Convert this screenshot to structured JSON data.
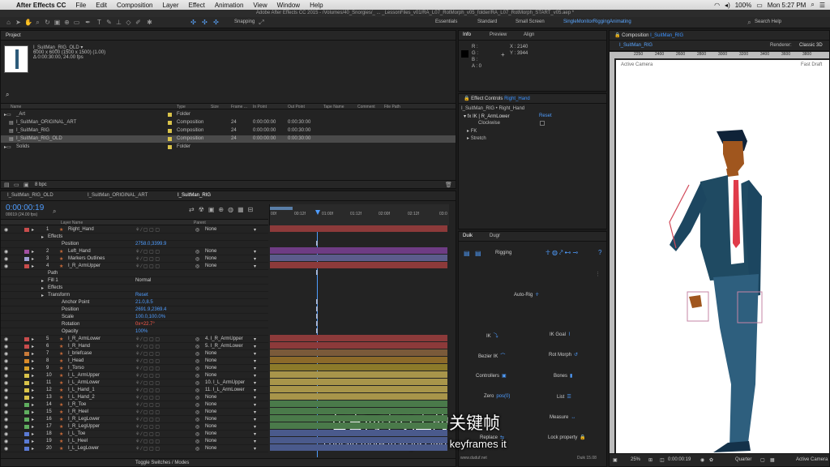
{
  "menubar": {
    "app_name": "After Effects CC",
    "items": [
      "File",
      "Edit",
      "Composition",
      "Layer",
      "Effect",
      "Animation",
      "View",
      "Window",
      "Help"
    ],
    "clock": "Mon 5:27 PM",
    "battery": "100%"
  },
  "window_title": "Adobe After Effects CC 2015 - /Volumes/40_Snorgies/_ ... _LessonFiles_v01/RA_L07_RotMorph_v05_folder/RA_L07_RotMorph_START_v05.aep *",
  "toolbar": {
    "snapping_label": "Snapping",
    "workspaces": [
      "Essentials",
      "Standard",
      "Small Screen",
      "SingleMonitorRiggingAnimating"
    ],
    "search_help": "Search Help"
  },
  "project": {
    "panel_title": "Project",
    "item_name": "I_SuitMan_RIG_OLD ▾",
    "item_dims": "6000 x 6000  (1500 x 1500) (1.00)",
    "item_duration": "Δ 0:00:30:00, 24.00 fps",
    "columns": [
      "Name",
      "Type",
      "Size",
      "Frame ...",
      "In Point",
      "Out Point",
      "Tape Name",
      "Comment",
      "File Path"
    ],
    "rows": [
      {
        "name": "_Art",
        "type": "Folder",
        "fps": "",
        "in": "",
        "out": "",
        "color": "#d9c34a"
      },
      {
        "name": "I_SuitMan_ORIGINAL_ART",
        "type": "Composition",
        "fps": "24",
        "in": "0:00:00:00",
        "out": "0:00:30:00",
        "color": "#d9c34a"
      },
      {
        "name": "I_SuitMan_RIG",
        "type": "Composition",
        "fps": "24",
        "in": "0:00:00:00",
        "out": "0:00:30:00",
        "color": "#d9c34a"
      },
      {
        "name": "I_SuitMan_RIG_OLD",
        "type": "Composition",
        "fps": "24",
        "in": "0:00:00:00",
        "out": "0:00:30:00",
        "color": "#d9c34a"
      },
      {
        "name": "Solids",
        "type": "Folder",
        "fps": "",
        "in": "",
        "out": "",
        "color": "#d9c34a"
      }
    ],
    "bpc": "8 bpc"
  },
  "info": {
    "tabs": [
      "Info",
      "Preview",
      "Align"
    ],
    "r": "R :",
    "g": "G :",
    "b": "B :",
    "a": "A : 0",
    "x": "X : 2140",
    "y": "Y : 3944"
  },
  "effect_controls": {
    "title": "Effect Controls",
    "layer": "Right_Hand",
    "path": "I_SuitMan_RIG • Right_Hand",
    "effect": "IK | R_ArmLower",
    "reset": "Reset",
    "props": [
      "Clockwise",
      "FK",
      "Stretch"
    ]
  },
  "duik": {
    "tabs": [
      "Duik",
      "Dugr"
    ],
    "rigging": "Rigging",
    "buttons": [
      "Auto-Rig",
      "IK",
      "IK Goal",
      "Bezier IK",
      "Rot Morph",
      "Controllers",
      "Bones",
      "Zero",
      "List",
      "Measure",
      "Replace",
      "Lock property"
    ],
    "url": "www.duduf.net",
    "version": "Duik 15.08"
  },
  "composition": {
    "panel_title": "Composition",
    "comp_name": "I_SuitMan_RIG",
    "tab": "I_SuitMan_RIG",
    "renderer_label": "Renderer:",
    "renderer": "Classic 3D",
    "camera": "Active Camera",
    "draft": "Fast Draft",
    "ruler": [
      "2250",
      "2400",
      "2600",
      "2800",
      "3000",
      "3200",
      "3400",
      "3600",
      "3800"
    ],
    "zoom": "25%",
    "time": "0:00:00:19",
    "resolution": "Quarter",
    "view": "Active Camera"
  },
  "timeline": {
    "tabs": [
      "I_SuitMan_RIG_OLD",
      "I_SuitMan_ORIGINAL_ART",
      "I_SuitMan_RIG"
    ],
    "timecode": "0:00:00:19",
    "frame": "00019 (24.00 fps)",
    "col_layer": "Layer Name",
    "col_parent": "Parent",
    "ruler": [
      "00f",
      "00:12f",
      "01:00f",
      "01:12f",
      "02:00f",
      "02:12f",
      "03:0"
    ],
    "footer": "Toggle Switches / Modes",
    "rows": [
      {
        "num": "1",
        "name": "Right_Hand",
        "parent": "None",
        "color": "#c94c4c",
        "bar": "#8c3a3a",
        "kind": "layer"
      },
      {
        "num": "",
        "name": "Effects",
        "parent": "",
        "color": "",
        "bar": "",
        "kind": "prop"
      },
      {
        "num": "",
        "name": "Position",
        "value": "2758.0,3399.9",
        "parent": "",
        "color": "",
        "bar": "",
        "kind": "prop"
      },
      {
        "num": "2",
        "name": "Left_Hand",
        "parent": "None",
        "color": "#a24fa2",
        "bar": "#6e3c84",
        "kind": "layer"
      },
      {
        "num": "3",
        "name": "Markers Outlines",
        "parent": "None",
        "color": "#9fa0d4",
        "bar": "#5c5c8c",
        "kind": "layer"
      },
      {
        "num": "4",
        "name": "I_R_ArmUpper",
        "parent": "None",
        "color": "#c94c4c",
        "bar": "#8c3a3a",
        "kind": "layer"
      },
      {
        "num": "",
        "name": "Path",
        "parent": "",
        "color": "",
        "bar": "",
        "kind": "prop"
      },
      {
        "num": "",
        "name": "Fill 1",
        "value": "Normal",
        "parent": "",
        "color": "",
        "bar": "",
        "kind": "prop"
      },
      {
        "num": "",
        "name": "Effects",
        "parent": "",
        "color": "",
        "bar": "",
        "kind": "prop"
      },
      {
        "num": "",
        "name": "Transform",
        "value": "Reset",
        "parent": "",
        "color": "",
        "bar": "",
        "kind": "prop"
      },
      {
        "num": "",
        "name": "Anchor Point",
        "value": "21.0,8.5",
        "parent": "",
        "color": "",
        "bar": "",
        "kind": "prop"
      },
      {
        "num": "",
        "name": "Position",
        "value": "2691.9,2369.4",
        "parent": "",
        "color": "",
        "bar": "",
        "kind": "prop"
      },
      {
        "num": "",
        "name": "Scale",
        "value": "100.0,100.0%",
        "parent": "",
        "color": "",
        "bar": "",
        "kind": "prop"
      },
      {
        "num": "",
        "name": "Rotation",
        "value": "0x+22.7°",
        "parent": "",
        "color": "",
        "bar": "",
        "kind": "prop"
      },
      {
        "num": "",
        "name": "Opacity",
        "value": "100%",
        "parent": "",
        "color": "",
        "bar": "",
        "kind": "prop"
      },
      {
        "num": "5",
        "name": "I_R_ArmLower",
        "parent": "4. I_R_ArmUpper",
        "color": "#c94c4c",
        "bar": "#8c3a3a",
        "kind": "layer"
      },
      {
        "num": "6",
        "name": "I_R_Hand",
        "parent": "5. I_R_ArmLower",
        "color": "#c94c4c",
        "bar": "#8c3a3a",
        "kind": "layer"
      },
      {
        "num": "7",
        "name": "I_briefcase",
        "parent": "None",
        "color": "#c97a3a",
        "bar": "#7a5a3a",
        "kind": "layer"
      },
      {
        "num": "8",
        "name": "I_Head",
        "parent": "None",
        "color": "#d98a2a",
        "bar": "#8c6a2a",
        "kind": "layer"
      },
      {
        "num": "9",
        "name": "I_Torso",
        "parent": "None",
        "color": "#d9a02a",
        "bar": "#8c7a2a",
        "kind": "layer"
      },
      {
        "num": "10",
        "name": "I_L_ArmUpper",
        "parent": "None",
        "color": "#d9c34a",
        "bar": "#a8954a",
        "kind": "layer"
      },
      {
        "num": "11",
        "name": "I_L_ArmLower",
        "parent": "10. I_L_ArmUpper",
        "color": "#d9c34a",
        "bar": "#a8954a",
        "kind": "layer"
      },
      {
        "num": "12",
        "name": "I_L_Hand_1",
        "parent": "11. I_L_ArmLower",
        "color": "#d9c34a",
        "bar": "#a8954a",
        "kind": "layer"
      },
      {
        "num": "13",
        "name": "I_L_Hand_2",
        "parent": "None",
        "color": "#d9c34a",
        "bar": "#a8954a",
        "kind": "layer"
      },
      {
        "num": "14",
        "name": "I_R_Toe",
        "parent": "None",
        "color": "#5fae5f",
        "bar": "#4a7a4a",
        "kind": "layer"
      },
      {
        "num": "15",
        "name": "I_R_Heel",
        "parent": "None",
        "color": "#5fae5f",
        "bar": "#4a7a4a",
        "kind": "layer"
      },
      {
        "num": "16",
        "name": "I_R_LegLower",
        "parent": "None",
        "color": "#5fae5f",
        "bar": "#4a7a4a",
        "kind": "layer"
      },
      {
        "num": "17",
        "name": "I_R_LegUpper",
        "parent": "None",
        "color": "#5fae5f",
        "bar": "#4a7a4a",
        "kind": "layer"
      },
      {
        "num": "18",
        "name": "I_L_Toe",
        "parent": "None",
        "color": "#5a7ad4",
        "bar": "#4a5a8c",
        "kind": "layer"
      },
      {
        "num": "19",
        "name": "I_L_Heel",
        "parent": "None",
        "color": "#5a7ad4",
        "bar": "#4a5a8c",
        "kind": "layer"
      },
      {
        "num": "20",
        "name": "I_L_LegLower",
        "parent": "None",
        "color": "#5a7ad4",
        "bar": "#4a5a8c",
        "kind": "layer"
      }
    ]
  },
  "subtitles": {
    "zh": "包含两个以上的关键帧",
    "en": "contain more than just two keyframes it"
  }
}
